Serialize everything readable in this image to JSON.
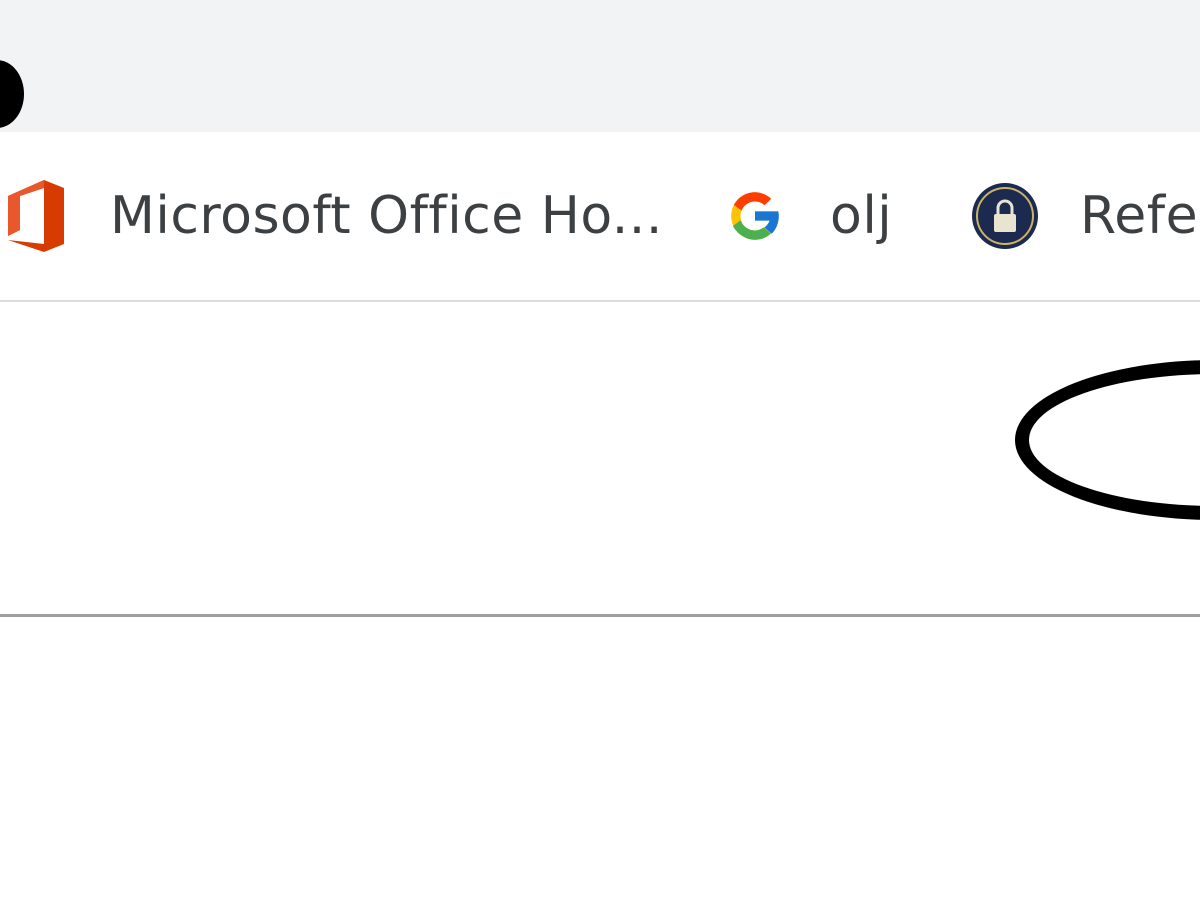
{
  "bookmarks": [
    {
      "label": "Microsoft Office Ho...",
      "icon": "office-icon"
    },
    {
      "label": "olj",
      "icon": "google-icon"
    },
    {
      "label": "Refer",
      "icon": "ref-lock-icon"
    }
  ],
  "colors": {
    "top_strip": "#f1f3f4",
    "text": "#3c4043",
    "annotation": "#000000"
  }
}
